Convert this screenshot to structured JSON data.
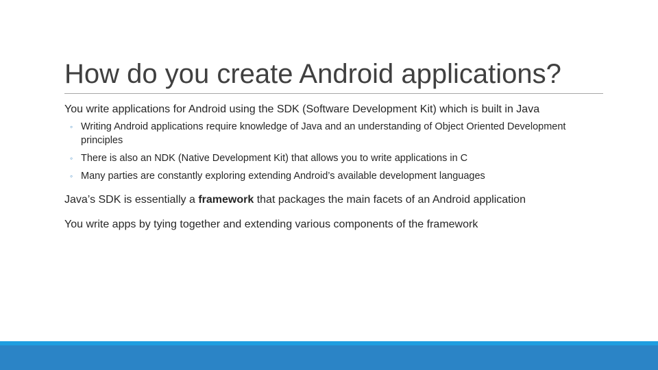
{
  "slide": {
    "title": "How do you create Android applications?",
    "intro": "You write applications for Android using the SDK (Software Development Kit) which is built in Java",
    "sub_items": [
      "Writing Android applications require knowledge of Java and an understanding of Object Oriented Development principles",
      "There is also an NDK (Native Development Kit) that allows you to write applications in C",
      "Many parties are constantly exploring extending Android’s available development languages"
    ],
    "bullet_glyph": "◦",
    "para2": {
      "before": "Java’s SDK is essentially a ",
      "bold": "framework",
      "after": " that packages the main facets of an Android application"
    },
    "para3": "You write apps by tying together and extending various components of the framework"
  },
  "colors": {
    "footer": "#2b84c6",
    "bullet": "#4a90c8"
  }
}
